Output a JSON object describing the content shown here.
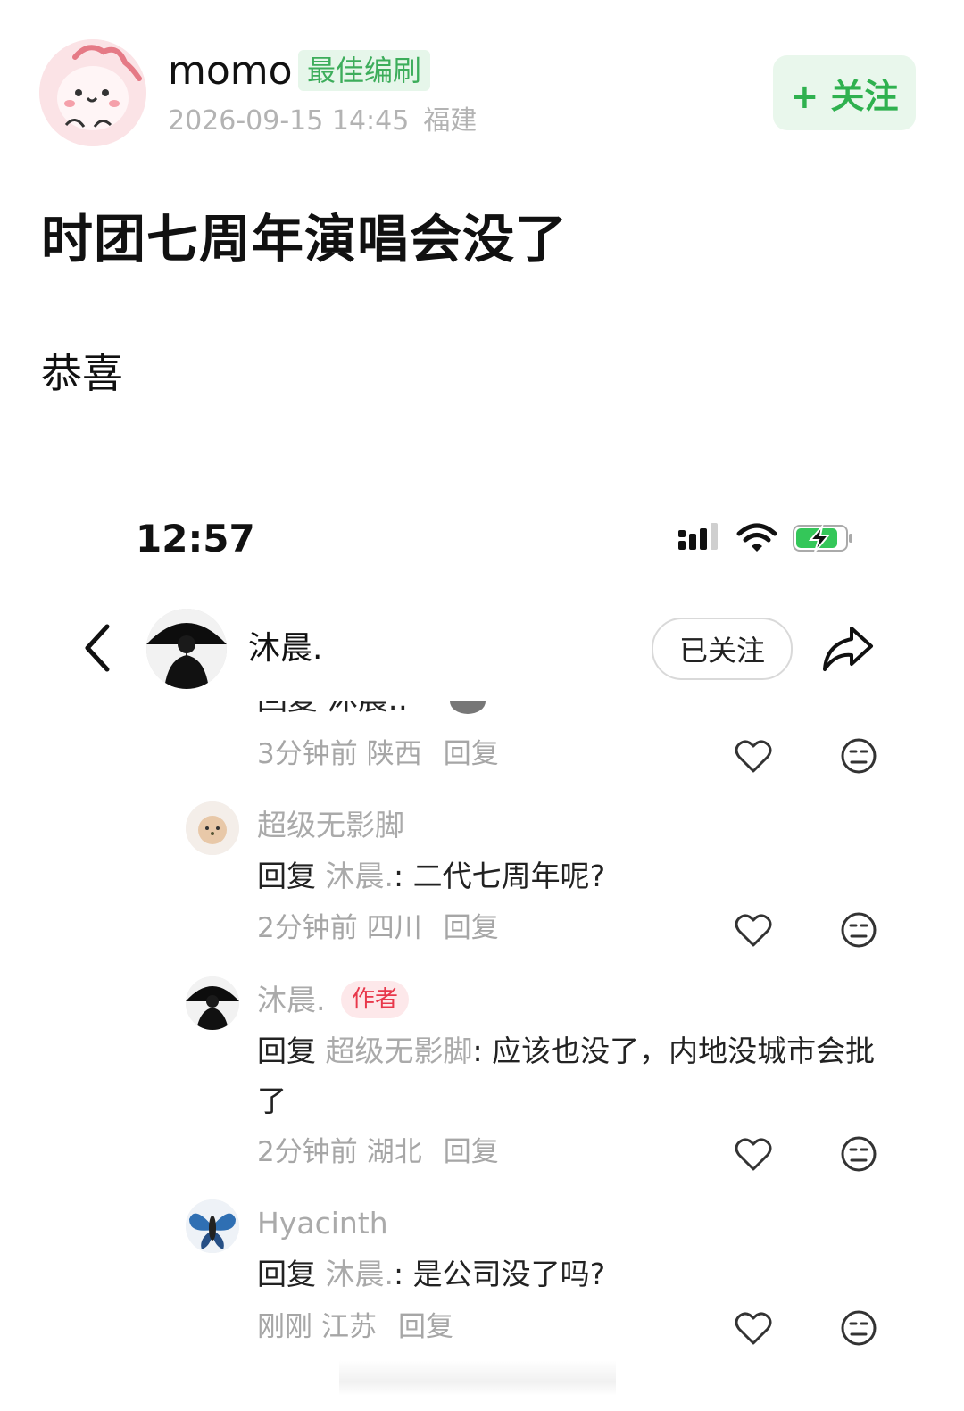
{
  "post": {
    "username": "momo",
    "badge": "最佳编刷",
    "datetime": "2026-09-15 14:45",
    "location": "福建",
    "follow_label": "+ 关注",
    "title": "时团七周年演唱会没了",
    "body": "恭喜"
  },
  "screenshot": {
    "status_bar": {
      "time": "12:57"
    },
    "header": {
      "name": "沐晨.",
      "followed_label": "已关注"
    },
    "cutoff_text": "回复 沐晨.: ·",
    "comments": [
      {
        "meta_time": "3分钟前",
        "meta_location": "陕西",
        "reply_label": "回复"
      },
      {
        "name": "超级无影脚",
        "reply_prefix": "回复",
        "reply_target": "沐晨.",
        "text": ": 二代七周年呢?",
        "meta_time": "2分钟前",
        "meta_location": "四川",
        "reply_label": "回复"
      },
      {
        "name": "沐晨.",
        "author_tag": "作者",
        "reply_prefix": "回复",
        "reply_target": "超级无影脚",
        "text": ": 应该也没了，内地没城市会批了",
        "meta_time": "2分钟前",
        "meta_location": "湖北",
        "reply_label": "回复"
      },
      {
        "name": "Hyacinth",
        "reply_prefix": "回复",
        "reply_target": "沐晨.",
        "text": ": 是公司没了吗?",
        "meta_time": "刚刚",
        "meta_location": "江苏",
        "reply_label": "回复"
      }
    ]
  },
  "colors": {
    "accent_green": "#2fb14f",
    "badge_green_bg": "#e6f6ea",
    "author_red": "#e8384b",
    "muted_gray": "#aaaaaa"
  },
  "icons": [
    "back-chevron-icon",
    "share-icon",
    "heart-icon",
    "neutral-face-icon",
    "signal-icon",
    "wifi-icon",
    "battery-charging-icon"
  ]
}
